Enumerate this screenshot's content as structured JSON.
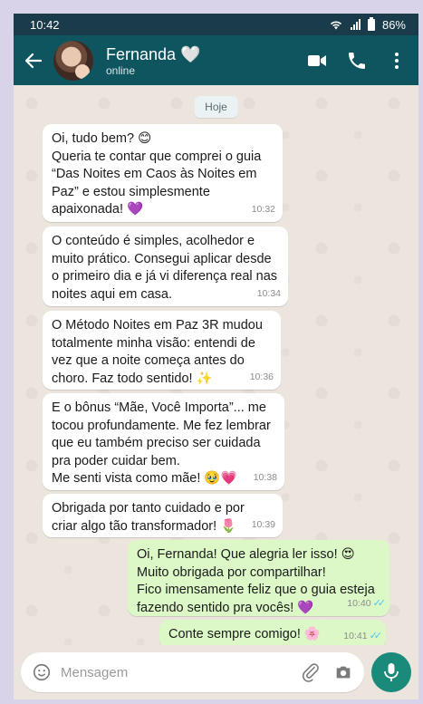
{
  "status": {
    "time": "10:42",
    "battery": "86%"
  },
  "header": {
    "name": "Fernanda",
    "name_emoji": "🤍",
    "status": "online"
  },
  "chat": {
    "day": "Hoje",
    "messages": [
      {
        "text": "Oi, tudo bem? 😊\nQueria te contar que comprei o guia “Das Noites em Caos às Noites em Paz” e estou simplesmente apaixonada! 💜",
        "time": "10:32"
      },
      {
        "text": "O conteúdo é simples, acolhedor e muito prático. Consegui aplicar desde o primeiro dia e já vi diferença real nas noites aqui em casa.",
        "time": "10:34"
      },
      {
        "text": "O Método Noites em Paz 3R mudou totalmente minha visão: entendi de vez que a noite começa antes do choro. Faz todo sentido! ✨",
        "time": "10:36"
      },
      {
        "text": "E o bônus “Mãe, Você Importa”... me tocou profundamente. Me fez lembrar que eu também preciso ser cuidada pra poder cuidar bem.\nMe senti vista como mãe! 🥹💗",
        "time": "10:38"
      },
      {
        "text": "Obrigada por tanto cuidado e por criar algo tão transformador! 🌷",
        "time": "10:39"
      },
      {
        "text": "Oi, Fernanda! Que alegria ler isso! 😍\nMuito obrigada por compartilhar!\nFico imensamente feliz que o guia esteja fazendo sentido pra vocês! 💜",
        "time": "10:40"
      },
      {
        "text": "Conte sempre comigo! 🌸",
        "time": "10:41"
      }
    ]
  },
  "input": {
    "placeholder": "Mensagem"
  },
  "icons": {
    "back": "arrow-left-icon",
    "video": "video-camera-icon",
    "call": "phone-icon",
    "menu": "more-vertical-icon",
    "emoji": "emoji-icon",
    "attach": "paperclip-icon",
    "camera": "camera-icon",
    "mic": "microphone-icon"
  },
  "colors": {
    "header": "#0f5560",
    "outgoing": "#dcf8c6",
    "incoming": "#ffffff",
    "mic": "#1a8a7a"
  }
}
